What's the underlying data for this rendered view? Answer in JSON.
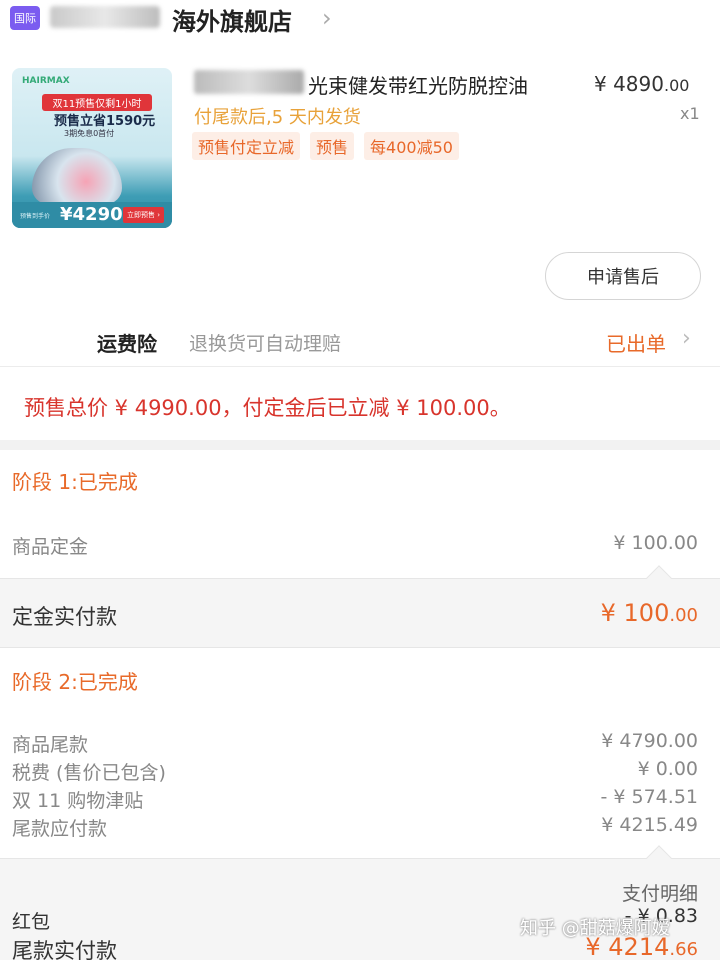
{
  "store": {
    "badge": "国际",
    "name": "海外旗舰店",
    "chevron": "›"
  },
  "product": {
    "image": {
      "brand": "HAIRMAX",
      "headline": "双11预售仅剩1小时",
      "saving": "预售立省1590元",
      "installment": "3期免息0首付",
      "price_label": "预售到手价",
      "price": "¥4290",
      "button": "立即预售 ›"
    },
    "title": "光束健发带红光防脱控油",
    "price": "¥ 4890",
    "price_decimals": ".00",
    "qty": "x1",
    "ship_note": "付尾款后,5 天内发货",
    "tags": [
      "预售付定立减",
      "预售",
      "每400减50"
    ]
  },
  "after_sale_button": "申请售后",
  "insurance": {
    "label": "运费险",
    "desc": "退换货可自动理赔",
    "status": "已出单",
    "chevron": "›"
  },
  "presale_note": "预售总价 ¥ 4990.00，付定金后已立减 ¥ 100.00。",
  "stage1": {
    "title": "阶段 1:已完成",
    "rows": [
      {
        "label": "商品定金",
        "value": "¥ 100.00"
      }
    ],
    "paid_label": "定金实付款",
    "paid_value": "¥ 100",
    "paid_decimals": ".00"
  },
  "stage2": {
    "title": "阶段 2:已完成",
    "rows": [
      {
        "label": "商品尾款",
        "value": "¥ 4790.00"
      },
      {
        "label": "税费 (售价已包含)",
        "value": "¥ 0.00"
      },
      {
        "label": "双 11 购物津贴",
        "value": "- ¥ 574.51"
      },
      {
        "label": "尾款应付款",
        "value": "¥ 4215.49"
      }
    ],
    "detail_link": "支付明细",
    "red_packet_label": "红包",
    "red_packet_value": "- ¥ 0.83",
    "paid_label": "尾款实付款",
    "paid_value": "¥ 4214",
    "paid_decimals": ".66"
  },
  "watermark": "知乎 @甜菇爆阿嫒"
}
